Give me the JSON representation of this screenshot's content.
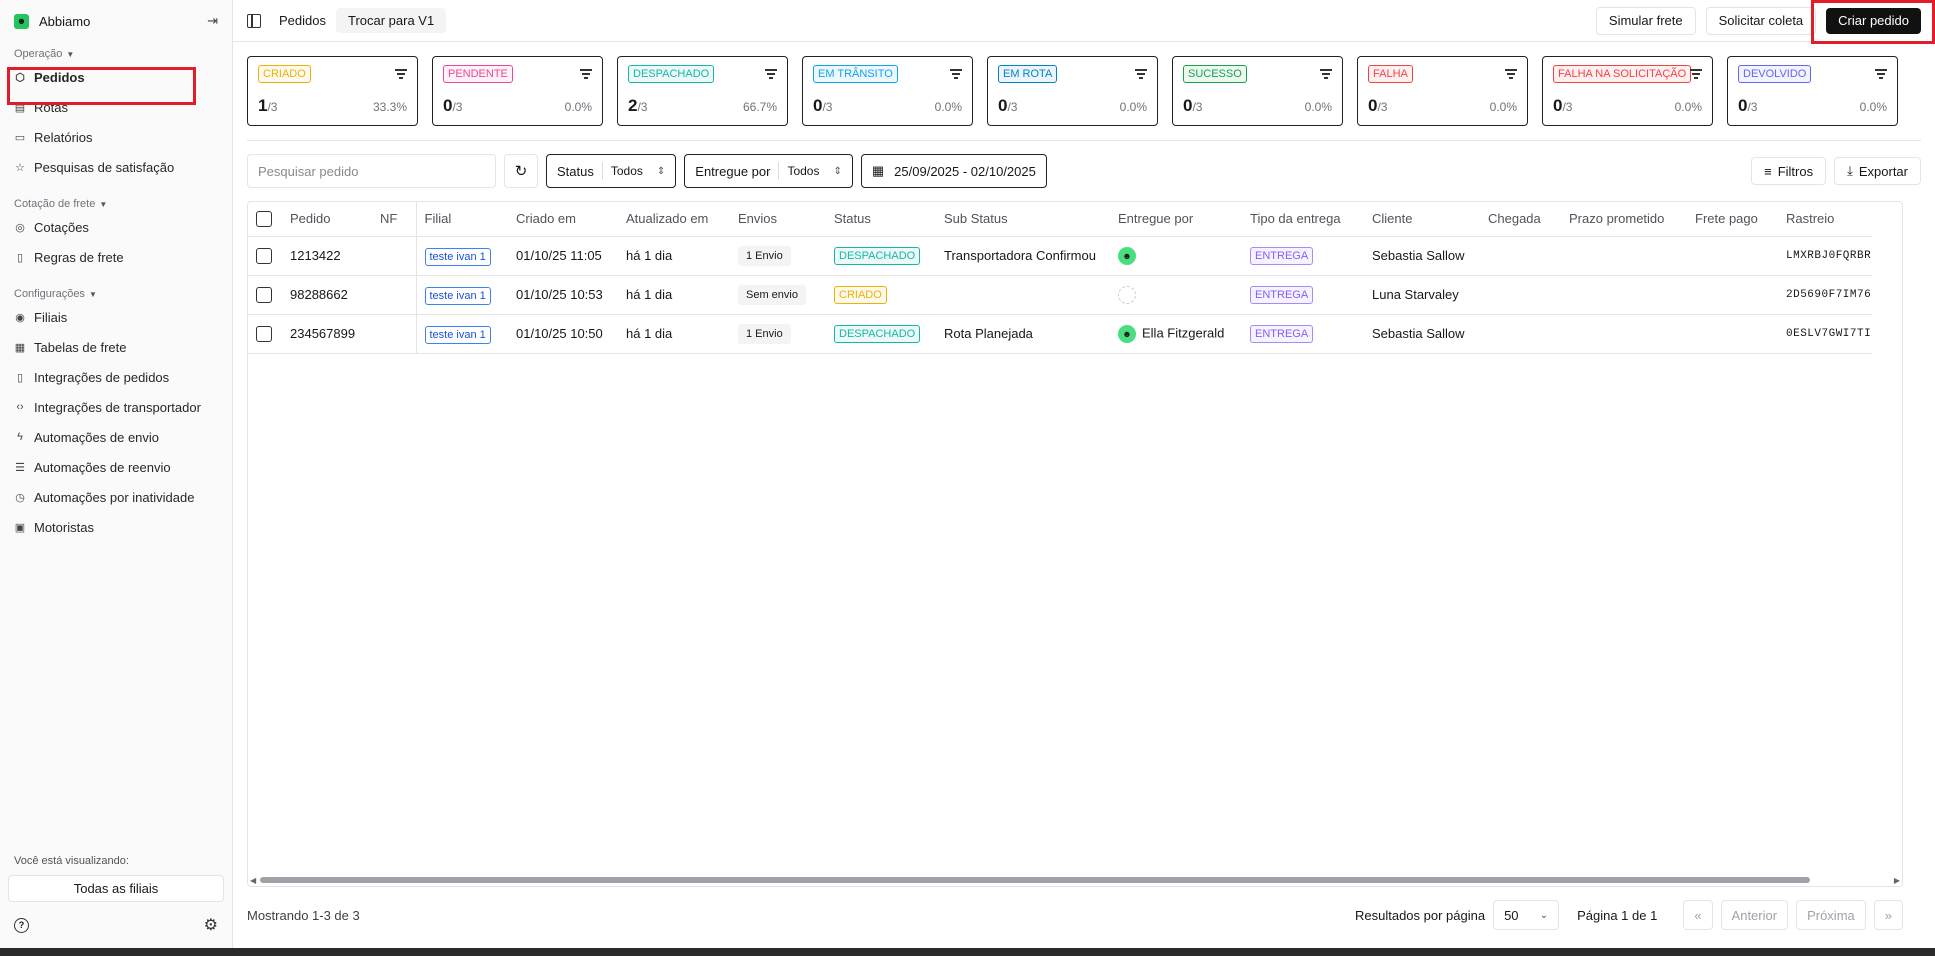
{
  "sidebar": {
    "brand": "Abbiamo",
    "sections": [
      {
        "label": "Operação",
        "items": [
          {
            "label": "Pedidos",
            "icon": "box-icon"
          },
          {
            "label": "Rotas",
            "icon": "map-icon"
          },
          {
            "label": "Relatórios",
            "icon": "file-icon"
          },
          {
            "label": "Pesquisas de satisfação",
            "icon": "star-icon"
          }
        ]
      },
      {
        "label": "Cotação de frete",
        "items": [
          {
            "label": "Cotações",
            "icon": "dollar-circle-icon"
          },
          {
            "label": "Regras de frete",
            "icon": "doc-icon"
          }
        ]
      },
      {
        "label": "Configurações",
        "items": [
          {
            "label": "Filiais",
            "icon": "pin-icon"
          },
          {
            "label": "Tabelas de frete",
            "icon": "table-icon"
          },
          {
            "label": "Integrações de pedidos",
            "icon": "doc-icon"
          },
          {
            "label": "Integrações de transportador",
            "icon": "code-icon"
          },
          {
            "label": "Automações de envio",
            "icon": "bolt-icon"
          },
          {
            "label": "Automações de reenvio",
            "icon": "list-icon"
          },
          {
            "label": "Automações por inatividade",
            "icon": "clock-icon"
          },
          {
            "label": "Motoristas",
            "icon": "id-card-icon"
          }
        ]
      }
    ],
    "viewing_label": "Você está visualizando:",
    "branch_button": "Todas as filiais"
  },
  "topbar": {
    "title": "Pedidos",
    "switch_label": "Trocar para V1",
    "simulate_label": "Simular frete",
    "collect_label": "Solicitar coleta",
    "create_label": "Criar pedido"
  },
  "cards": [
    {
      "label": "CRIADO",
      "value": "1",
      "total": "/3",
      "pct": "33.3%",
      "color": "#eab308"
    },
    {
      "label": "PENDENTE",
      "value": "0",
      "total": "/3",
      "pct": "0.0%",
      "color": "#ec4899"
    },
    {
      "label": "DESPACHADO",
      "value": "2",
      "total": "/3",
      "pct": "66.7%",
      "color": "#14b8a6"
    },
    {
      "label": "EM TRÂNSITO",
      "value": "0",
      "total": "/3",
      "pct": "0.0%",
      "color": "#0ea5e9"
    },
    {
      "label": "EM ROTA",
      "value": "0",
      "total": "/3",
      "pct": "0.0%",
      "color": "#0284c7"
    },
    {
      "label": "SUCESSO",
      "value": "0",
      "total": "/3",
      "pct": "0.0%",
      "color": "#16a34a"
    },
    {
      "label": "FALHA",
      "value": "0",
      "total": "/3",
      "pct": "0.0%",
      "color": "#ef4444"
    },
    {
      "label": "FALHA NA SOLICITAÇÃO",
      "value": "0",
      "total": "/3",
      "pct": "0.0%",
      "color": "#ef4444"
    },
    {
      "label": "DEVOLVIDO",
      "value": "0",
      "total": "/3",
      "pct": "0.0%",
      "color": "#6366f1"
    }
  ],
  "toolbar": {
    "search_placeholder": "Pesquisar pedido",
    "status_label": "Status",
    "status_value": "Todos",
    "delivered_label": "Entregue por",
    "delivered_value": "Todos",
    "date_range": "25/09/2025 - 02/10/2025",
    "filters_label": "Filtros",
    "export_label": "Exportar"
  },
  "table": {
    "columns": [
      "Pedido",
      "NF",
      "Filial",
      "Criado em",
      "Atualizado em",
      "Envios",
      "Status",
      "Sub Status",
      "Entregue por",
      "Tipo da entrega",
      "Cliente",
      "Chegada",
      "Prazo prometido",
      "Frete pago",
      "Rastreio"
    ],
    "rows": [
      {
        "pedido": "1213422",
        "nf": "",
        "filial": "teste ivan 1",
        "criado": "01/10/25 11:05",
        "atualizado": "há 1 dia",
        "envios": "1 Envio",
        "status": "DESPACHADO",
        "status_color": "#14b8a6",
        "sub_status": "Transportadora Confirmou",
        "entregue": "",
        "entregue_avatar": "filled",
        "tipo": "ENTREGA",
        "cliente": "Sebastia Sallow",
        "chegada": "",
        "prazo": "",
        "frete": "",
        "rastreio": "LMXRBJ0FQRBR"
      },
      {
        "pedido": "98288662",
        "nf": "",
        "filial": "teste ivan 1",
        "criado": "01/10/25 10:53",
        "atualizado": "há 1 dia",
        "envios": "Sem envio",
        "status": "CRIADO",
        "status_color": "#eab308",
        "sub_status": "",
        "entregue": "",
        "entregue_avatar": "empty",
        "tipo": "ENTREGA",
        "cliente": "Luna Starvaley",
        "chegada": "",
        "prazo": "",
        "frete": "",
        "rastreio": "2D5690F7IM76"
      },
      {
        "pedido": "234567899",
        "nf": "",
        "filial": "teste ivan 1",
        "criado": "01/10/25 10:50",
        "atualizado": "há 1 dia",
        "envios": "1 Envio",
        "status": "DESPACHADO",
        "status_color": "#14b8a6",
        "sub_status": "Rota Planejada",
        "entregue": "Ella Fitzgerald",
        "entregue_avatar": "filled",
        "tipo": "ENTREGA",
        "cliente": "Sebastia Sallow",
        "chegada": "",
        "prazo": "",
        "frete": "",
        "rastreio": "0ESLV7GWI7TI"
      }
    ]
  },
  "footer": {
    "showing": "Mostrando 1-3 de 3",
    "per_page_label": "Resultados por página",
    "per_page_value": "50",
    "page_info": "Página 1 de 1",
    "first": "«",
    "prev": "Anterior",
    "next": "Próxima",
    "last": "»"
  }
}
